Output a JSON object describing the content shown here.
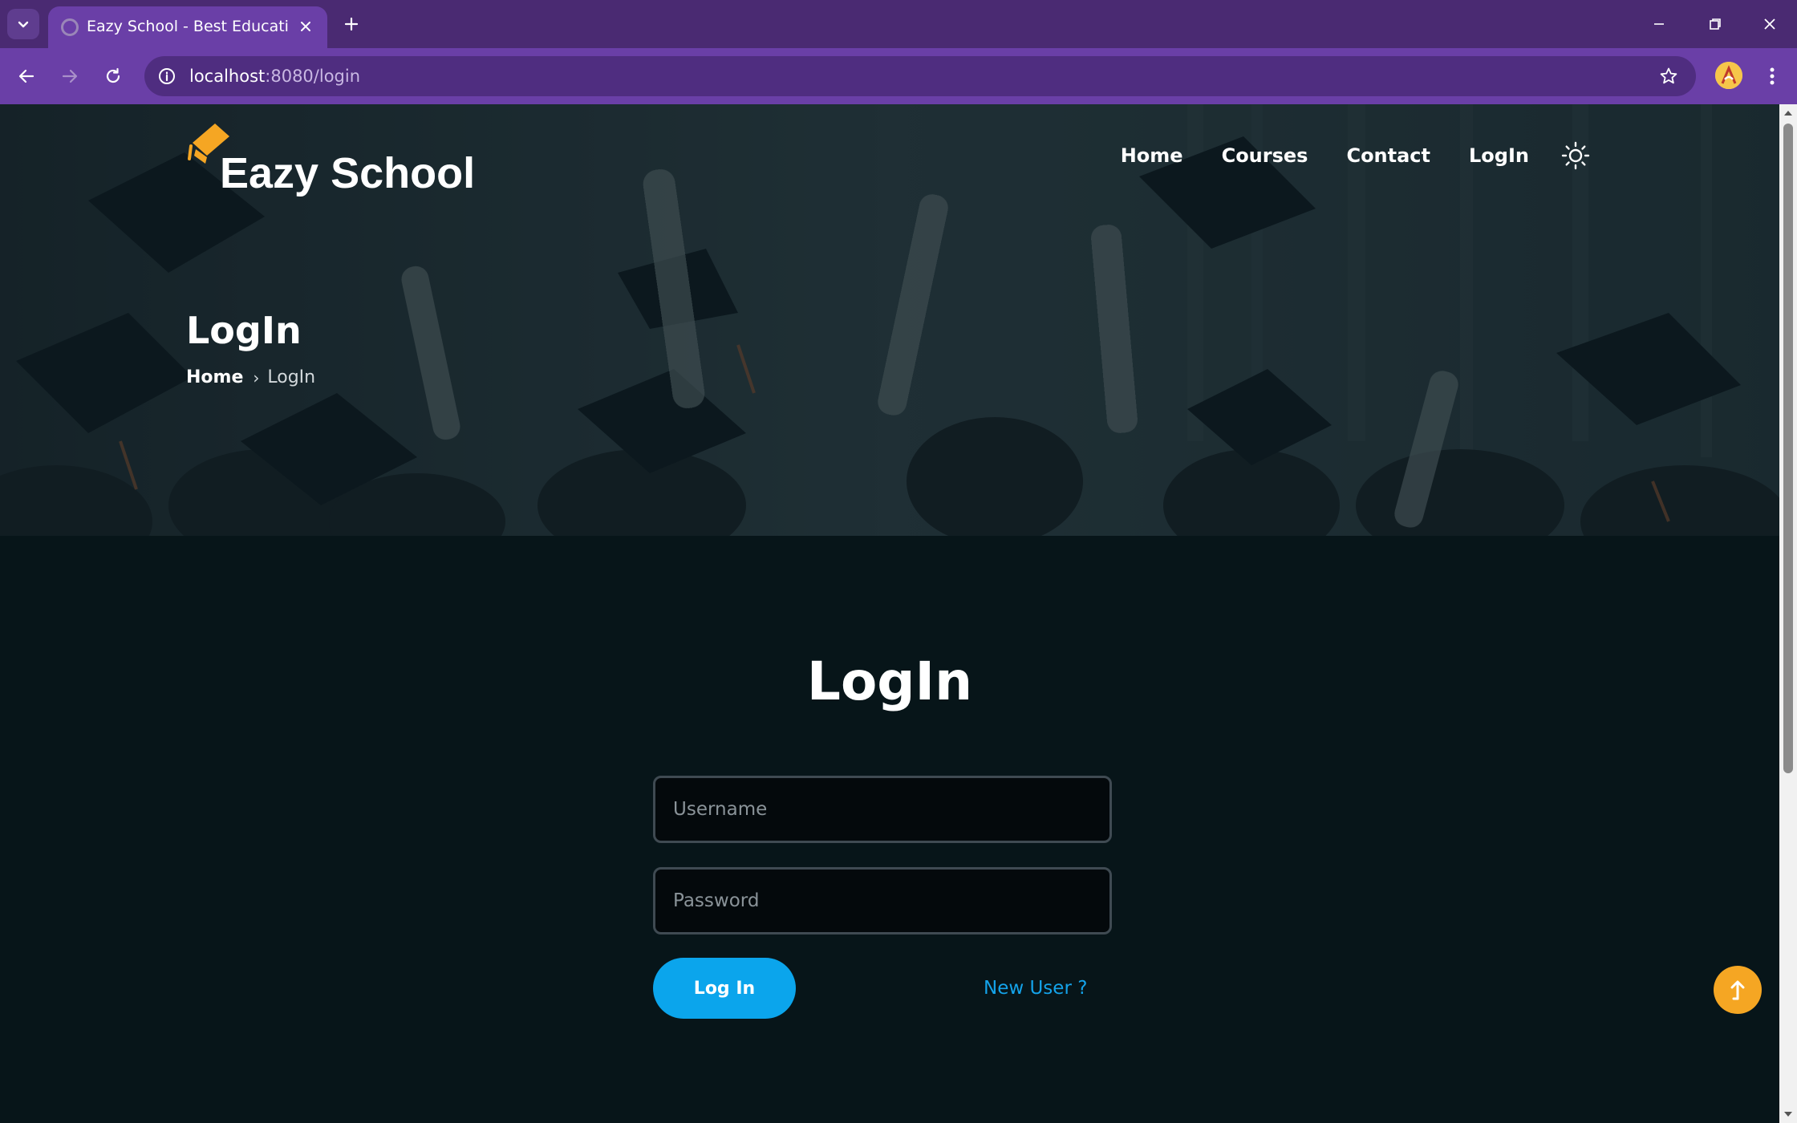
{
  "browser": {
    "tab_title": "Eazy School - Best Educational Institute",
    "url_host": "localhost",
    "url_rest": ":8080/login",
    "tab_active_color": "#6a3fa7",
    "frame_color": "#4a2a72"
  },
  "site": {
    "brand": "Eazy School",
    "nav": {
      "home": "Home",
      "courses": "Courses",
      "contact": "Contact",
      "login": "LogIn"
    }
  },
  "hero": {
    "title": "LogIn",
    "breadcrumb": {
      "home": "Home",
      "separator": "›",
      "current": "LogIn"
    }
  },
  "login": {
    "title": "LogIn",
    "username_placeholder": "Username",
    "password_placeholder": "Password",
    "submit_label": "Log In",
    "new_user_link": "New User ?",
    "accent_color": "#0ba5ec",
    "back_to_top_color": "#f5a623"
  }
}
